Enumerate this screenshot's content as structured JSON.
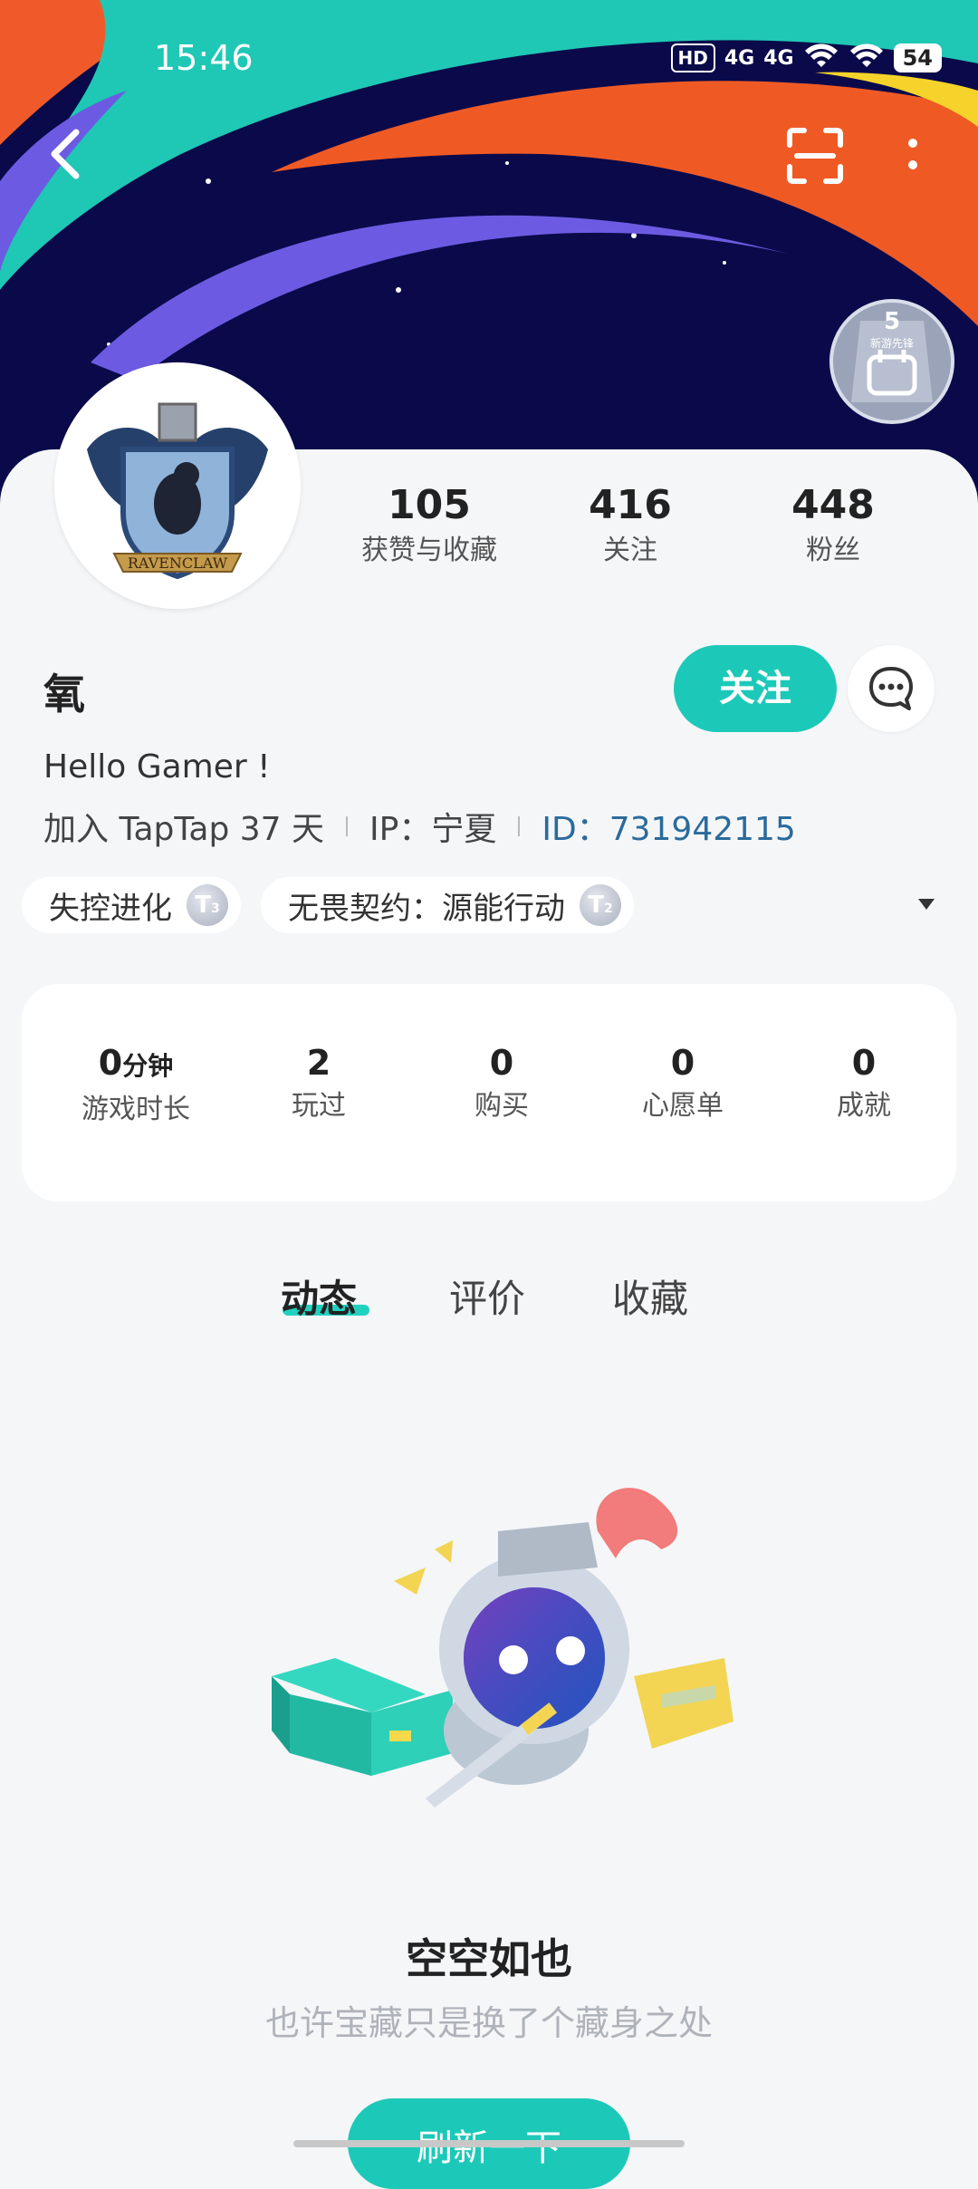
{
  "status_bar": {
    "time": "15:46",
    "network_1": "HD",
    "network_2": "4G",
    "network_3": "4G",
    "battery": "54"
  },
  "profile": {
    "username": "氧",
    "follow_label": "关注",
    "bio": "Hello Gamer !",
    "joined": "加入 TapTap 37 天",
    "ip": "IP：宁夏",
    "uid": "ID：731942115",
    "avatar_text": "RAVENCLAW",
    "badge_text": "5",
    "badge_sub": "新游先锋"
  },
  "stats": [
    {
      "num": "105",
      "label": "获赞与收藏"
    },
    {
      "num": "416",
      "label": "关注"
    },
    {
      "num": "448",
      "label": "粉丝"
    }
  ],
  "tags": [
    {
      "label": "失控进化",
      "coin": "T3"
    },
    {
      "label": "无畏契约：源能行动",
      "coin": "T2"
    }
  ],
  "game_stats": [
    {
      "num": "0",
      "unit": "分钟",
      "label": "游戏时长"
    },
    {
      "num": "2",
      "unit": "",
      "label": "玩过"
    },
    {
      "num": "0",
      "unit": "",
      "label": "购买"
    },
    {
      "num": "0",
      "unit": "",
      "label": "心愿单"
    },
    {
      "num": "0",
      "unit": "",
      "label": "成就"
    }
  ],
  "tabs": [
    "动态",
    "评价",
    "收藏"
  ],
  "empty": {
    "title": "空空如也",
    "subtitle": "也许宝藏只是换了个藏身之处",
    "refresh_label": "刷新一下"
  },
  "colors": {
    "accent": "#1cc9b8",
    "banner_bg": "#0a0a4a",
    "uid_text": "#2b6b9c"
  }
}
